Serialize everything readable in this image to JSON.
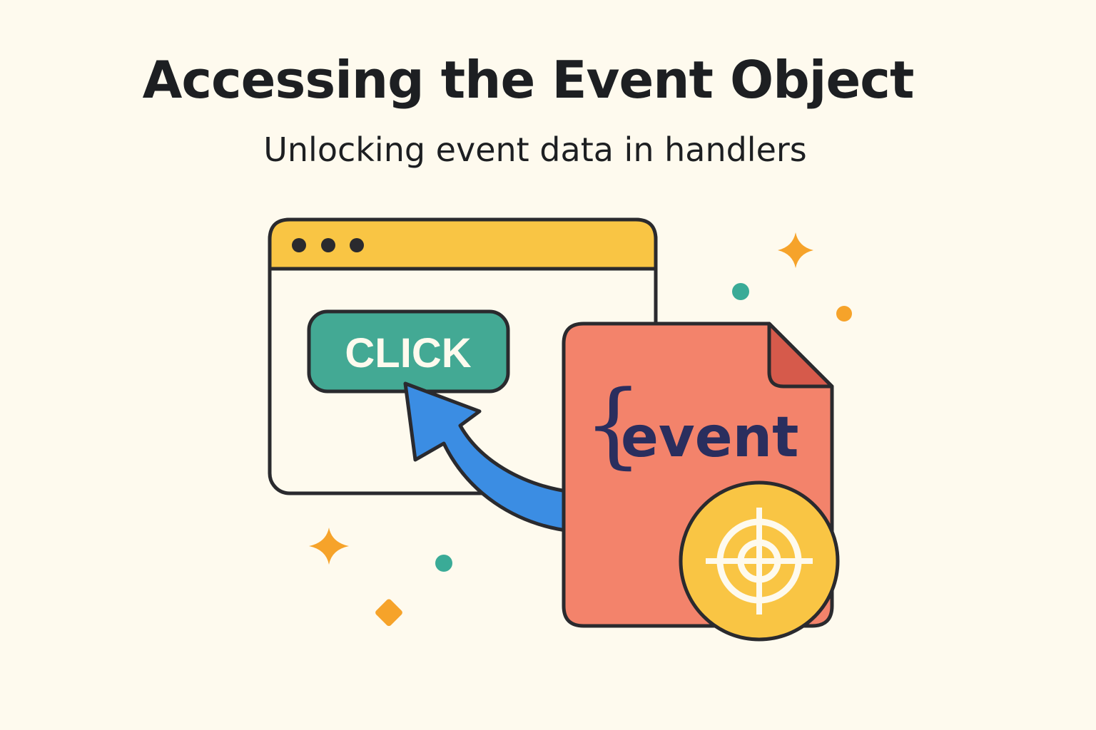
{
  "header": {
    "title": "Accessing the Event Object",
    "subtitle": "Unlocking event data in handlers"
  },
  "illustration": {
    "browser_window": {
      "button_label": "CLICK",
      "dots": 3
    },
    "event_document": {
      "brace": "{",
      "label": "event"
    },
    "icons": [
      "browser-window-icon",
      "cursor-arrow-icon",
      "document-icon",
      "target-icon",
      "sparkle-icon"
    ]
  },
  "colors": {
    "background": "#fefaee",
    "outline": "#2a2a2e",
    "window_bar": "#f9c544",
    "button": "#43a994",
    "arrow": "#3b8de3",
    "document": "#f3836b",
    "document_fold": "#d65a4b",
    "event_text": "#2a2e5e",
    "target_badge": "#f9c544",
    "sparkle_orange": "#f6a32a",
    "dot_teal": "#3aab97"
  }
}
